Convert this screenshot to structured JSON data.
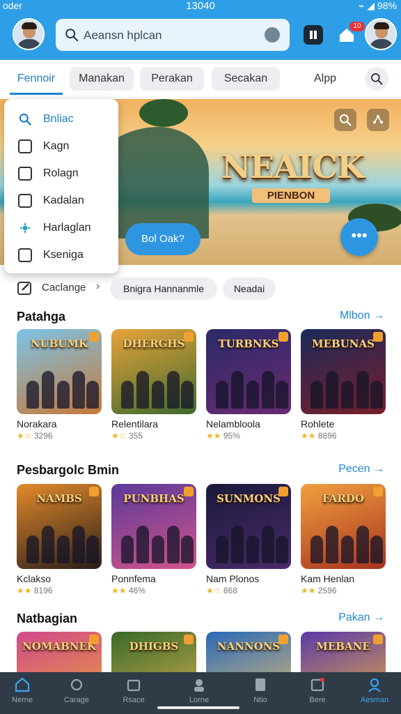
{
  "status": {
    "carrier": "oder",
    "time": "13040",
    "battery": "98%"
  },
  "header": {
    "search_placeholder": "Aeansn hplcan",
    "notif_count": "10"
  },
  "tabs": [
    {
      "label": "Fennoir"
    },
    {
      "label": "Manakan"
    },
    {
      "label": "Perakan"
    },
    {
      "label": "Secakan"
    },
    {
      "label": "Alpp"
    }
  ],
  "dropdown": [
    {
      "label": "Bnliac",
      "icon": "search-icon"
    },
    {
      "label": "Kagn",
      "icon": "square-icon"
    },
    {
      "label": "Rolagn",
      "icon": "card-icon"
    },
    {
      "label": "Kadalan",
      "icon": "shapes-icon"
    },
    {
      "label": "Harlaglan",
      "icon": "gear-icon"
    },
    {
      "label": "Kseniga",
      "icon": "folder-icon"
    }
  ],
  "banner": {
    "title": "NEAICK",
    "subtitle": "PIENBON",
    "cta": "Bol Oak?",
    "fab": "•••"
  },
  "categories": {
    "label": "Caclange",
    "chips": [
      "Bnigra Hannanmle",
      "Neadai"
    ]
  },
  "sections": [
    {
      "title": "Patahga",
      "more": "Mlbon →",
      "items": [
        {
          "name": "Norakara",
          "stars": "★☆",
          "rating": "3296",
          "art": "NUBUMK",
          "colors": [
            "#7cc4e8",
            "#c77838"
          ]
        },
        {
          "name": "Relentilara",
          "stars": "★☆",
          "rating": "355",
          "art": "DHERGHS",
          "colors": [
            "#e8a33a",
            "#3d6a2e"
          ]
        },
        {
          "name": "Nelambloola",
          "stars": "★★",
          "rating": "95%",
          "art": "TURBNKS",
          "colors": [
            "#2a2a68",
            "#6a2a72"
          ]
        },
        {
          "name": "Rohlete",
          "stars": "★★",
          "rating": "8896",
          "art": "MEBUNAS",
          "colors": [
            "#1b2a5a",
            "#7a1e2a"
          ]
        }
      ]
    },
    {
      "title": "Pesbargolc Bmin",
      "more": "Pecen →",
      "items": [
        {
          "name": "Kclakso",
          "stars": "★★",
          "rating": "8196",
          "art": "NAMBS",
          "colors": [
            "#e38a2a",
            "#2a1e1a"
          ]
        },
        {
          "name": "Ponnfema",
          "stars": "★★",
          "rating": "46%",
          "art": "PUNBHAS",
          "colors": [
            "#5a3a9a",
            "#d2548a"
          ]
        },
        {
          "name": "Nam Plonos",
          "stars": "★☆",
          "rating": "868",
          "art": "SUNMONS",
          "colors": [
            "#1a1a3a",
            "#4a2a6a"
          ]
        },
        {
          "name": "Kam Henlan",
          "stars": "★★",
          "rating": "2596",
          "art": "FARDO",
          "colors": [
            "#f0a040",
            "#a8321e"
          ]
        }
      ]
    },
    {
      "title": "Natbagian",
      "more": "Pakan →",
      "items": [
        {
          "name": "",
          "stars": "",
          "rating": "",
          "art": "NOMABNEK",
          "colors": [
            "#d14a8a",
            "#e8a23a"
          ]
        },
        {
          "name": "",
          "stars": "",
          "rating": "",
          "art": "DHIGBS",
          "colors": [
            "#3a6a2a",
            "#d8b050"
          ]
        },
        {
          "name": "",
          "stars": "",
          "rating": "",
          "art": "NANNONS",
          "colors": [
            "#2a6ab8",
            "#e8c070"
          ]
        },
        {
          "name": "",
          "stars": "",
          "rating": "",
          "art": "MEBANE",
          "colors": [
            "#5a3aa8",
            "#f0b040"
          ]
        }
      ]
    }
  ],
  "bottom_nav": [
    {
      "label": "Nerne",
      "icon": "home-icon"
    },
    {
      "label": "Carage",
      "icon": "refresh-icon"
    },
    {
      "label": "Rsace",
      "icon": "folder-icon"
    },
    {
      "label": "Lorne",
      "icon": "person-icon"
    },
    {
      "label": "Ntio",
      "icon": "doc-icon"
    },
    {
      "label": "Bere",
      "icon": "inbox-icon"
    },
    {
      "label": "Aesman",
      "icon": "profile-icon"
    }
  ]
}
